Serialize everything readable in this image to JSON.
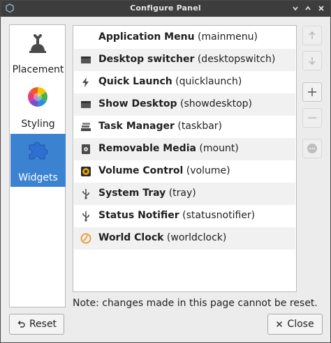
{
  "window": {
    "title": "Configure Panel"
  },
  "sidebar": {
    "items": [
      {
        "label": "Placement",
        "icon": "placement-icon"
      },
      {
        "label": "Styling",
        "icon": "color-wheel-icon"
      },
      {
        "label": "Widgets",
        "icon": "puzzle-piece-icon",
        "selected": true
      }
    ]
  },
  "widgets": [
    {
      "name": "Application Menu",
      "id": "(mainmenu)",
      "icon": "blank"
    },
    {
      "name": "Desktop switcher",
      "id": "(desktopswitch)",
      "icon": "desktop-switcher-icon"
    },
    {
      "name": "Quick Launch",
      "id": "(quicklaunch)",
      "icon": "lightning-icon"
    },
    {
      "name": "Show Desktop",
      "id": "(showdesktop)",
      "icon": "show-desktop-icon"
    },
    {
      "name": "Task Manager",
      "id": "(taskbar)",
      "icon": "taskbar-icon"
    },
    {
      "name": "Removable Media",
      "id": "(mount)",
      "icon": "removable-media-icon"
    },
    {
      "name": "Volume Control",
      "id": "(volume)",
      "icon": "volume-icon"
    },
    {
      "name": "System Tray",
      "id": "(tray)",
      "icon": "usb-icon"
    },
    {
      "name": "Status Notifier",
      "id": "(statusnotifier)",
      "icon": "usb-icon"
    },
    {
      "name": "World Clock",
      "id": "(worldclock)",
      "icon": "clock-icon"
    }
  ],
  "note": "Note: changes made in this page cannot be reset.",
  "buttons": {
    "reset": "Reset",
    "close": "Close"
  },
  "colors": {
    "selection": "#3b83d1",
    "titlebar": "#3d3d3d",
    "clock": "#e8962b",
    "volume": "#e0a400"
  }
}
